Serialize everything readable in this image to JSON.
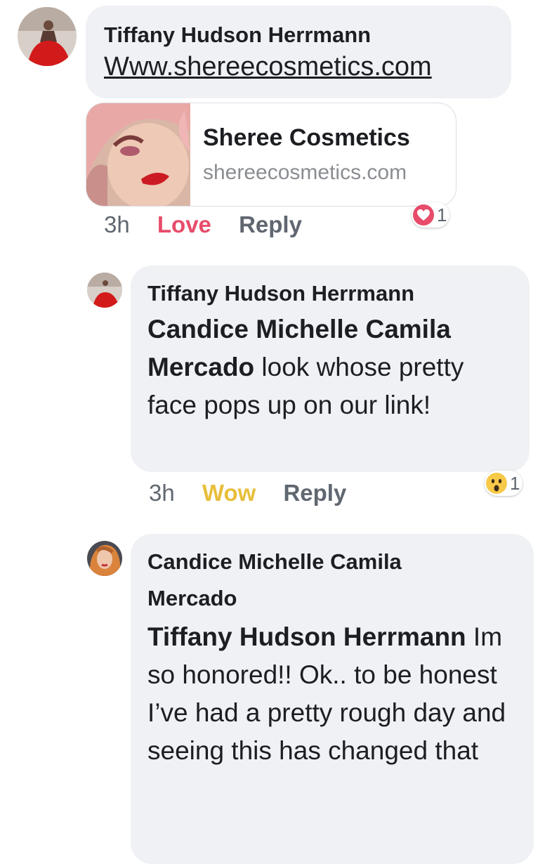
{
  "comments": [
    {
      "author": "Tiffany Hudson Herrmann",
      "link_text": "Www.shereecosmetics.com",
      "preview": {
        "title": "Sheree Cosmetics",
        "domain": "shereecosmetics.com"
      },
      "time": "3h",
      "reaction_label": "Love",
      "reply_label": "Reply",
      "reaction_count": "1",
      "reaction_icon": "heart-icon",
      "reaction_color": "#e74c6a"
    },
    {
      "author": "Tiffany Hudson Herrmann",
      "mention": "Candice Michelle Camila Mercado",
      "body": " look whose pretty face pops up on our link!",
      "time": "3h",
      "reaction_label": "Wow",
      "reply_label": "Reply",
      "reaction_count": "1",
      "reaction_icon": "wow-face-icon",
      "reaction_color": "#e8be3c"
    },
    {
      "author": "Candice Michelle Camila Mercado",
      "mention": "Tiffany Hudson Herrmann",
      "body": " Im so honored!! Ok.. to be honest I’ve had a pretty rough day and seeing this has changed that"
    }
  ]
}
